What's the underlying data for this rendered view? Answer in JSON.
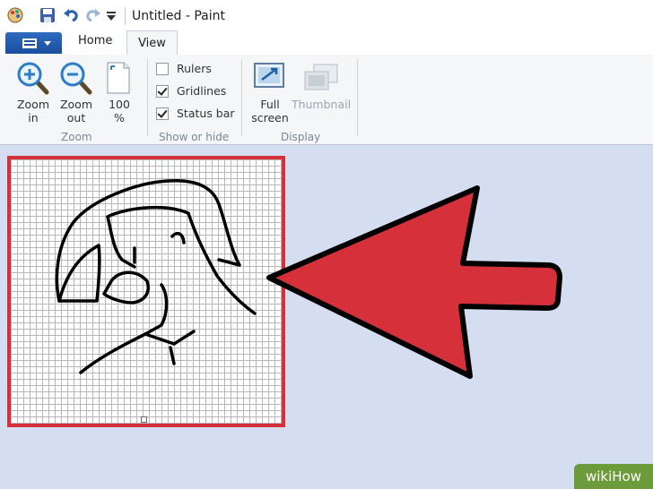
{
  "window": {
    "title": "Untitled - Paint"
  },
  "tabs": {
    "home": "Home",
    "view": "View"
  },
  "ribbon": {
    "zoom_in": [
      "Zoom",
      "in"
    ],
    "zoom_out": [
      "Zoom",
      "out"
    ],
    "zoom_100": [
      "100",
      "%"
    ],
    "zoom_group": "Zoom",
    "rulers": {
      "label": "Rulers",
      "checked": false
    },
    "gridlines": {
      "label": "Gridlines",
      "checked": true
    },
    "status_bar": {
      "label": "Status bar",
      "checked": true
    },
    "show_hide_group": "Show or hide",
    "full_screen": [
      "Full",
      "screen"
    ],
    "thumbnail": "Thumbnail",
    "display_group": "Display"
  },
  "colors": {
    "canvas_border": "#d6303b",
    "arrow_fill": "#d6303b",
    "ribbon_bg": "#f5f6f7",
    "workspace_bg": "#d4def0"
  },
  "watermark": "wikiHow"
}
